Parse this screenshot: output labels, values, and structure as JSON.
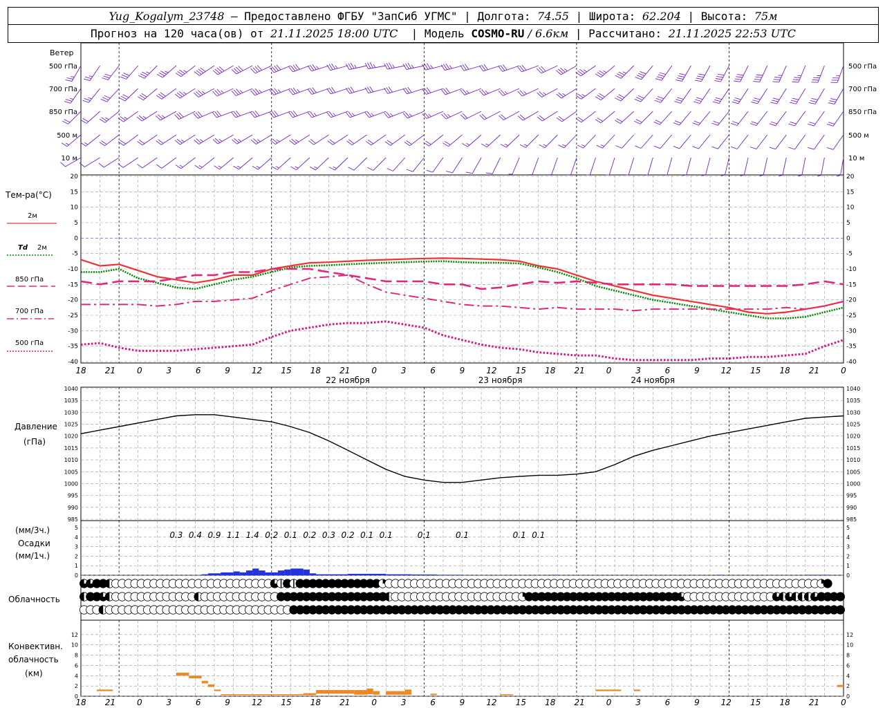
{
  "header": {
    "station": "Yug_Kogalym_23748",
    "provider": " — Предоставлено ФГБУ \"ЗапСиб УГМС\" | Долгота: ",
    "lon": "74.55",
    "lat_label": " | Широта: ",
    "lat": "62.204",
    "alt_label": " | Высота: ",
    "alt": "75м",
    "forecast_label": "Прогноз на 120 часа(ов) от ",
    "forecast_time": "21.11.2025 18:00 UTC",
    "model_label": "  | Модель ",
    "model": "COSMO-RU",
    "resolution": " / 6.6км",
    "calc_label": " | Рассчитано: ",
    "calc_time": "21.11.2025 22:53 UTC"
  },
  "labels": {
    "wind": "Ветер",
    "wind_levels": [
      "500 гПа",
      "700 гПа",
      "850 гПа",
      "500 м",
      "10  м"
    ],
    "temp": "Тем-ра(°С)",
    "t2m": "2м",
    "td_sym": "Td",
    "td2m": "2м",
    "t850": "850 гПа",
    "t700": "700 гПа",
    "t500": "500 гПа",
    "pressure": "Давление",
    "pressure_unit": "(гПа)",
    "precip_unit3": "(мм/3ч.)",
    "precip": "Осадки",
    "precip_unit1": "(мм/1ч.)",
    "cloud": "Облачность",
    "conv1": "Конвективн.",
    "conv2": "облачность",
    "conv3": "(км)"
  },
  "time_axis": {
    "ticks": [
      "18",
      "21",
      "0",
      "3",
      "6",
      "9",
      "12",
      "15",
      "18",
      "21",
      "0",
      "3",
      "6",
      "9",
      "12",
      "15",
      "18",
      "21",
      "0",
      "3",
      "6",
      "9",
      "12",
      "15",
      "18",
      "21",
      "0"
    ],
    "days": [
      "22 ноября",
      "23 ноября",
      "24 ноября"
    ]
  },
  "colors": {
    "t2m": "#ee3333",
    "td": "#008800",
    "t850": "#e0287a",
    "t700": "#e0287a",
    "t500": "#dd1188",
    "wind": "#7722cc",
    "pressure": "#000000",
    "precip": "#2233dd",
    "conv": "#ee8822",
    "grid": "#999999"
  },
  "chart_data": [
    {
      "type": "line",
      "title": "Тем-ра(°С)",
      "ylim": [
        -40,
        20
      ],
      "yticks": [
        "20",
        "15",
        "10",
        "5",
        "0",
        "-5",
        "-10",
        "-15",
        "-20",
        "-25",
        "-30",
        "-35",
        "-40"
      ],
      "x_hours": [
        0,
        3,
        6,
        9,
        12,
        15,
        18,
        21,
        24,
        27,
        30,
        33,
        36,
        39,
        42,
        45,
        48,
        51,
        54,
        57,
        60,
        63,
        66,
        69,
        72,
        75,
        78,
        81,
        84,
        87,
        90,
        93,
        96,
        99,
        102,
        105,
        108,
        111,
        114,
        117,
        120
      ],
      "series": [
        {
          "name": "2м",
          "values": [
            -7,
            -9,
            -8.5,
            -10.5,
            -12.5,
            -13.5,
            -14.5,
            -13.5,
            -12,
            -12,
            -10,
            -9,
            -8,
            -7.8,
            -7.5,
            -7.2,
            -7,
            -6.8,
            -6.6,
            -6.5,
            -6.6,
            -6.8,
            -7,
            -7.5,
            -9,
            -10,
            -12,
            -14,
            -15.5,
            -17,
            -18.5,
            -19.5,
            -20.5,
            -21.5,
            -22.5,
            -24,
            -24.5,
            -24,
            -23,
            -22,
            -20.5
          ]
        },
        {
          "name": "Td 2м",
          "values": [
            -11,
            -11,
            -10,
            -13,
            -14.5,
            -16,
            -16.5,
            -15,
            -13.5,
            -12.5,
            -11,
            -9.5,
            -9,
            -8.8,
            -8.5,
            -8.2,
            -8,
            -7.8,
            -7.6,
            -7.5,
            -7.8,
            -8,
            -8,
            -8.2,
            -9.5,
            -11,
            -13,
            -15.5,
            -17,
            -18.5,
            -20,
            -21,
            -22,
            -23,
            -24,
            -25,
            -26,
            -26,
            -25.5,
            -24,
            -22.5
          ]
        },
        {
          "name": "850 гПа",
          "values": [
            -14,
            -15,
            -14,
            -14,
            -14,
            -13,
            -12,
            -12,
            -11,
            -11,
            -10,
            -10,
            -10,
            -11,
            -12,
            -13,
            -14,
            -14,
            -14,
            -15,
            -15,
            -16.5,
            -16,
            -15,
            -14,
            -14.5,
            -14,
            -14.5,
            -15,
            -15,
            -15,
            -15,
            -15.5,
            -15.5,
            -15.5,
            -15.5,
            -15.5,
            -15.5,
            -15,
            -14,
            -15
          ]
        },
        {
          "name": "700 гПа",
          "values": [
            -21.5,
            -21.5,
            -21.5,
            -21.5,
            -22,
            -21.5,
            -20.5,
            -20.5,
            -20,
            -19.5,
            -17,
            -15,
            -13,
            -12.5,
            -12,
            -15,
            -17.5,
            -18.5,
            -19.5,
            -20.5,
            -21.5,
            -22,
            -22,
            -22.5,
            -23,
            -22.5,
            -23,
            -23,
            -23,
            -23.5,
            -23,
            -23,
            -23,
            -23,
            -23,
            -23,
            -23,
            -22.5,
            -23,
            -22,
            -20.5
          ]
        },
        {
          "name": "500 гПа",
          "values": [
            -34.5,
            -34,
            -35.5,
            -36.5,
            -36.5,
            -36.5,
            -36,
            -35.5,
            -35,
            -34.5,
            -32,
            -30,
            -29,
            -28,
            -27.5,
            -27.5,
            -27,
            -28,
            -29,
            -31.5,
            -33,
            -34.5,
            -35.5,
            -36,
            -37,
            -37.5,
            -38,
            -38,
            -39,
            -39.5,
            -39.5,
            -39.5,
            -39.5,
            -39,
            -39,
            -38.5,
            -38.5,
            -38,
            -37.5,
            -35,
            -33
          ]
        }
      ]
    },
    {
      "type": "line",
      "title": "Давление (гПа)",
      "ylim": [
        985,
        1040
      ],
      "yticks": [
        "1040",
        "1035",
        "1030",
        "1025",
        "1020",
        "1015",
        "1010",
        "1005",
        "1000",
        "995",
        "990",
        "985"
      ],
      "x_hours": [
        0,
        3,
        6,
        9,
        12,
        15,
        18,
        21,
        24,
        27,
        30,
        33,
        36,
        39,
        42,
        45,
        48,
        51,
        54,
        57,
        60,
        63,
        66,
        69,
        72,
        75,
        78,
        81,
        84,
        87,
        90,
        93,
        96,
        99,
        102,
        105,
        108,
        111,
        114,
        117,
        120
      ],
      "series": [
        {
          "name": "Давление",
          "values": [
            1021,
            1022.5,
            1024,
            1025.5,
            1027,
            1028.5,
            1029,
            1029,
            1028,
            1027,
            1026,
            1024,
            1021.5,
            1018,
            1014,
            1010,
            1006,
            1003,
            1001.5,
            1000.5,
            1000.5,
            1001.5,
            1002.5,
            1003,
            1003.5,
            1003.5,
            1004,
            1005,
            1008,
            1011.5,
            1014,
            1016,
            1018,
            1020,
            1021.5,
            1023,
            1024.5,
            1026,
            1027.5,
            1028,
            1028.5
          ]
        }
      ]
    },
    {
      "type": "bar",
      "title": "Осадки (мм/1ч.)",
      "ylim": [
        0,
        5
      ],
      "yticks": [
        "5",
        "4",
        "3",
        "2",
        "1",
        "0"
      ],
      "labels_3h": [
        {
          "hour": 15,
          "value": "0.3"
        },
        {
          "hour": 18,
          "value": "0.4"
        },
        {
          "hour": 21,
          "value": "0.9"
        },
        {
          "hour": 24,
          "value": "1.1"
        },
        {
          "hour": 27,
          "value": "1.4"
        },
        {
          "hour": 30,
          "value": "0.2"
        },
        {
          "hour": 33,
          "value": "0.1"
        },
        {
          "hour": 36,
          "value": "0.2"
        },
        {
          "hour": 39,
          "value": "0.3"
        },
        {
          "hour": 42,
          "value": "0.2"
        },
        {
          "hour": 45,
          "value": "0.1"
        },
        {
          "hour": 48,
          "value": "0.1"
        },
        {
          "hour": 54,
          "value": "0.1"
        },
        {
          "hour": 60,
          "value": "0.1"
        },
        {
          "hour": 69,
          "value": "0.1"
        },
        {
          "hour": 72,
          "value": "0.1"
        }
      ],
      "bars": [
        {
          "h0": 19,
          "h1": 20,
          "v": 0.1
        },
        {
          "h0": 20,
          "h1": 22,
          "v": 0.2
        },
        {
          "h0": 22,
          "h1": 24,
          "v": 0.3
        },
        {
          "h0": 24,
          "h1": 25,
          "v": 0.4
        },
        {
          "h0": 25,
          "h1": 26,
          "v": 0.3
        },
        {
          "h0": 26,
          "h1": 27,
          "v": 0.5
        },
        {
          "h0": 27,
          "h1": 28,
          "v": 0.7
        },
        {
          "h0": 28,
          "h1": 29,
          "v": 0.5
        },
        {
          "h0": 29,
          "h1": 30,
          "v": 0.3
        },
        {
          "h0": 30,
          "h1": 31,
          "v": 0.3
        },
        {
          "h0": 31,
          "h1": 32,
          "v": 0.5
        },
        {
          "h0": 32,
          "h1": 33,
          "v": 0.6
        },
        {
          "h0": 33,
          "h1": 35,
          "v": 0.7
        },
        {
          "h0": 35,
          "h1": 36,
          "v": 0.6
        },
        {
          "h0": 36,
          "h1": 37,
          "v": 0.2
        },
        {
          "h0": 37,
          "h1": 42,
          "v": 0.1
        },
        {
          "h0": 42,
          "h1": 44,
          "v": 0.15
        },
        {
          "h0": 44,
          "h1": 48,
          "v": 0.15
        },
        {
          "h0": 48,
          "h1": 52,
          "v": 0.1
        },
        {
          "h0": 52,
          "h1": 56,
          "v": 0.08
        },
        {
          "h0": 56,
          "h1": 60,
          "v": 0.05
        },
        {
          "h0": 74,
          "h1": 75,
          "v": 0.05
        },
        {
          "h0": 100,
          "h1": 101,
          "v": 0.05
        },
        {
          "h0": 114,
          "h1": 118,
          "v": 0.05
        }
      ]
    },
    {
      "type": "bar",
      "title": "Конвективн. облачность (км)",
      "ylim": [
        0,
        14
      ],
      "yticks": [
        "12",
        "10",
        "8",
        "6",
        "4",
        "2",
        "0"
      ],
      "segments": [
        {
          "h0": 2.5,
          "h1": 5,
          "base": 1,
          "top": 1.3
        },
        {
          "h0": 15,
          "h1": 17,
          "base": 4,
          "top": 4.6
        },
        {
          "h0": 17,
          "h1": 19,
          "base": 3.5,
          "top": 4
        },
        {
          "h0": 19,
          "h1": 20,
          "base": 2.5,
          "top": 3
        },
        {
          "h0": 20,
          "h1": 21,
          "base": 1.8,
          "top": 2.3
        },
        {
          "h0": 21,
          "h1": 22,
          "base": 1,
          "top": 1.3
        },
        {
          "h0": 22,
          "h1": 35,
          "base": 0.2,
          "top": 0.4
        },
        {
          "h0": 35,
          "h1": 37,
          "base": 0.2,
          "top": 0.6
        },
        {
          "h0": 37,
          "h1": 43,
          "base": 0.5,
          "top": 1.2
        },
        {
          "h0": 43,
          "h1": 45,
          "base": 0.3,
          "top": 1.2
        },
        {
          "h0": 45,
          "h1": 46,
          "base": 0.4,
          "top": 1.5
        },
        {
          "h0": 46,
          "h1": 47,
          "base": 0.3,
          "top": 1
        },
        {
          "h0": 48,
          "h1": 51,
          "base": 0.3,
          "top": 1
        },
        {
          "h0": 51,
          "h1": 52,
          "base": 0.3,
          "top": 1.3
        },
        {
          "h0": 55,
          "h1": 56,
          "base": 0.2,
          "top": 0.5
        },
        {
          "h0": 66,
          "h1": 68,
          "base": 0.2,
          "top": 0.4
        },
        {
          "h0": 81,
          "h1": 85,
          "base": 1,
          "top": 1.3
        },
        {
          "h0": 87,
          "h1": 88,
          "base": 1,
          "top": 1.3
        },
        {
          "h0": 119,
          "h1": 120,
          "base": 1.8,
          "top": 2.2
        }
      ]
    }
  ],
  "cloud_rows": [
    "TTFFHOOOOOOOOOOOOOOOOOOOOOOOOOTPFPFFFFFFFFFFFFFQOOOOOOOOOOOOOOOOOOOOOOOOOOOOOOOOOOOOOOOOOOOOOOOOOOOOOOOOOOOOOOOOOOOOQF",
    "HFFTHOOOOOOOOOOOOOHOOOOOOOOOOOOFFFFFFFFFFFFFFFFFHOOOOOOOOOOOOOOOOOOOOQFFFFFFFFFFFFFFFFFFFFFFFFTOOOOOOOOOOOOOOTHTHHHTFFFF",
    "OOOHOOOOOOOOOOOOOOOOOOOOOOOOOOOOOFFFFFFFFFFFFFFFFFFFFFFFFFFFFFFFFFFFFFFFFFFFFFFFFFFFFFFFFFFFFFFFFFFFFFFFFFFFFFFFFFFFFFFF"
  ]
}
